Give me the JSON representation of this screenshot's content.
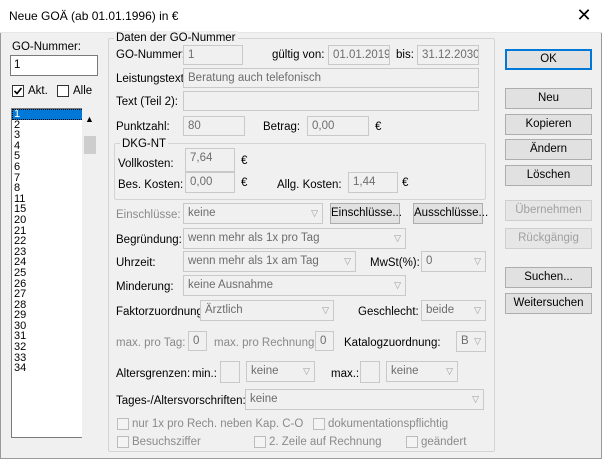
{
  "window": {
    "title": "Neue GOÄ (ab 01.01.1996) in €"
  },
  "left": {
    "go_nummer_label": "GO-Nummer:",
    "go_nummer_value": "1",
    "akt_label": "Akt.",
    "alle_label": "Alle",
    "list_items": [
      "1",
      "2",
      "3",
      "4",
      "5",
      "6",
      "7",
      "8",
      "11",
      "15",
      "20",
      "21",
      "22",
      "23",
      "24",
      "25",
      "26",
      "27",
      "28",
      "29",
      "30",
      "31",
      "32",
      "33",
      "34"
    ],
    "selected_index": 0
  },
  "daten": {
    "group_title": "Daten der GO-Nummer",
    "go_nummer_label": "GO-Nummer:",
    "go_nummer_value": "1",
    "gueltig_label": "gültig von:",
    "gueltig_von": "01.01.2019",
    "bis_label": "bis:",
    "gueltig_bis": "31.12.2030",
    "leistungstext_label": "Leistungstext:",
    "leistungstext_value": "Beratung auch telefonisch",
    "text2_label": "Text (Teil 2):",
    "text2_value": "",
    "punktzahl_label": "Punktzahl:",
    "punktzahl_value": "80",
    "betrag_label": "Betrag:",
    "betrag_value": "0,00",
    "euro": "€"
  },
  "dkg": {
    "group_title": "DKG-NT",
    "vollkosten_label": "Vollkosten:",
    "vollkosten_value": "7,64",
    "bes_label": "Bes. Kosten:",
    "bes_value": "0,00",
    "allg_label": "Allg. Kosten:",
    "allg_value": "1,44",
    "euro": "€"
  },
  "einschluesse": {
    "label": "Einschlüsse:",
    "value": "keine",
    "btn_einschluesse": "Einschlüsse...",
    "btn_ausschluesse": "Ausschlüsse..."
  },
  "begruendung": {
    "label": "Begründung:",
    "value": "wenn mehr als 1x pro Tag"
  },
  "uhrzeit": {
    "label": "Uhrzeit:",
    "value": "wenn mehr als 1x am Tag",
    "mwst_label": "MwSt(%):",
    "mwst_value": "0"
  },
  "minderung": {
    "label": "Minderung:",
    "value": "keine Ausnahme"
  },
  "faktor": {
    "label": "Faktorzuordnung:",
    "value": "Ärztlich",
    "geschlecht_label": "Geschlecht:",
    "geschlecht_value": "beide"
  },
  "max": {
    "pro_tag_label": "max. pro Tag:",
    "pro_tag_value": "0",
    "pro_rechnung_label": "max. pro Rechnung:",
    "pro_rechnung_value": "0",
    "katalog_label": "Katalogzuordnung:",
    "katalog_value": "B"
  },
  "alter": {
    "label": "Altersgrenzen:",
    "min_label": "min.:",
    "min_unit": "keine",
    "max_label": "max.:",
    "max_unit": "keine"
  },
  "tages": {
    "label": "Tages-/Altersvorschriften:",
    "value": "keine"
  },
  "checks": {
    "nur1x": "nur 1x pro Rech. neben Kap. C-O",
    "doku": "dokumentationspflichtig",
    "besuch": "Besuchsziffer",
    "zeile2": "2. Zeile auf Rechnung",
    "geaendert": "geändert"
  },
  "buttons": {
    "ok": "OK",
    "neu": "Neu",
    "kopieren": "Kopieren",
    "aendern": "Ändern",
    "loeschen": "Löschen",
    "uebernehmen": "Übernehmen",
    "rueckgaengig": "Rückgängig",
    "suchen": "Suchen...",
    "weitersuchen": "Weitersuchen"
  }
}
